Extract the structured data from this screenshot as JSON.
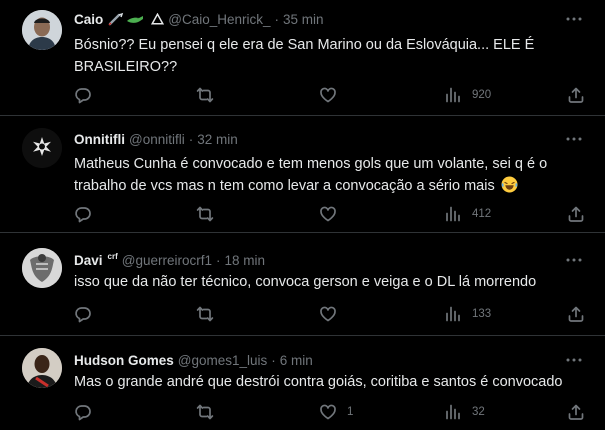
{
  "tweets": [
    {
      "display_name": "Caio",
      "badges": "💉🐊 △",
      "handle": "@Caio_Henrick_",
      "time": "35 min",
      "text": "Bósnio?? Eu pensei q ele era de San Marino ou da Eslováquia... ELE É BRASILEIRO??",
      "reply_count": "",
      "retweet_count": "",
      "like_count": "",
      "view_count": "920"
    },
    {
      "display_name": "Onnitifli",
      "badges": "",
      "handle": "@onnitifli",
      "time": "32 min",
      "text": "Matheus Cunha é convocado e tem menos gols que um volante, sei q é o trabalho de vcs mas n tem como levar a convocação a sério mais",
      "text_emoji": "😂",
      "reply_count": "",
      "retweet_count": "",
      "like_count": "",
      "view_count": "412"
    },
    {
      "display_name": "Davi",
      "badges": "crf",
      "handle": "@guerreirocrf1",
      "time": "18 min",
      "text": "isso que da não ter técnico, convoca gerson e veiga e o DL lá morrendo",
      "reply_count": "",
      "retweet_count": "",
      "like_count": "",
      "view_count": "133"
    },
    {
      "display_name": "Hudson Gomes",
      "badges": "",
      "handle": "@gomes1_luis",
      "time": "6 min",
      "text": "Mas o grande andré que destrói contra goiás, coritiba e santos é convocado",
      "reply_count": "",
      "retweet_count": "",
      "like_count": "1",
      "view_count": "32"
    }
  ],
  "separator": "·",
  "colors": {
    "background": "#000000",
    "text_primary": "#e7e9ea",
    "text_secondary": "#71767b",
    "divider": "#2f3336",
    "like_count_color": "#71767b"
  },
  "icons": [
    "more-icon",
    "reply-icon",
    "retweet-icon",
    "like-icon",
    "views-icon",
    "share-icon"
  ]
}
